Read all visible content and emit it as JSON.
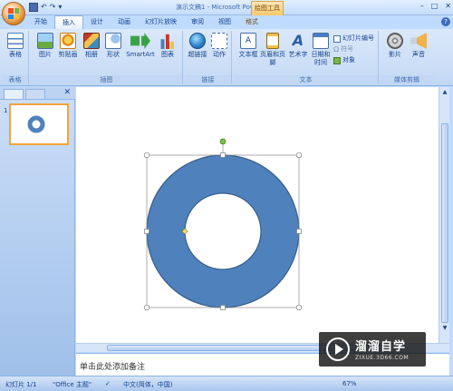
{
  "window": {
    "title": "演示文稿1 - Microsoft PowerPoint",
    "context_tab_group": "绘图工具",
    "controls": [
      "–",
      "□",
      "✕"
    ]
  },
  "qat": {
    "undo": "↶",
    "redo": "↷",
    "customize": "▾"
  },
  "tabs": [
    {
      "label": "开始",
      "active": false
    },
    {
      "label": "插入",
      "active": true
    },
    {
      "label": "设计",
      "active": false
    },
    {
      "label": "动画",
      "active": false
    },
    {
      "label": "幻灯片放映",
      "active": false
    },
    {
      "label": "审阅",
      "active": false
    },
    {
      "label": "视图",
      "active": false
    },
    {
      "label": "格式",
      "active": false,
      "contextual": true
    }
  ],
  "help": "?",
  "ribbon": {
    "groups": {
      "table": {
        "label": "表格",
        "buttons": [
          "表格"
        ]
      },
      "illustrations": {
        "label": "插图",
        "buttons": [
          "图片",
          "剪贴画",
          "相册",
          "形状",
          "SmartArt",
          "图表"
        ]
      },
      "links": {
        "label": "链接",
        "buttons": [
          "超链接",
          "动作"
        ]
      },
      "text": {
        "label": "文本",
        "buttons": [
          "文本框",
          "页眉和页脚",
          "艺术字",
          "日期和时间"
        ],
        "small_buttons": [
          "幻灯片编号",
          "符号",
          "对象"
        ]
      },
      "media": {
        "label": "媒体剪辑",
        "buttons": [
          "影片",
          "声音"
        ]
      }
    }
  },
  "slides_panel": {
    "close": "✕",
    "selected_slide": "1"
  },
  "notes": {
    "placeholder": "单击此处添加备注"
  },
  "status": {
    "slide": "幻灯片 1/1",
    "theme": "\"Office 主题\"",
    "language": "中文(简体，中国)",
    "zoom": "67%"
  },
  "watermark": {
    "brand": "溜溜自学",
    "url": "ZIXUE.3D66.COM"
  },
  "colors": {
    "shape_fill": "#4f81bd",
    "shape_outline": "#385d8a",
    "handle": "#ffffff",
    "rotate_handle": "#7ac142",
    "adjust_handle": "#f5e663"
  },
  "icons": [
    "office-button-icon",
    "save-icon",
    "undo-icon",
    "redo-icon",
    "help-icon"
  ]
}
